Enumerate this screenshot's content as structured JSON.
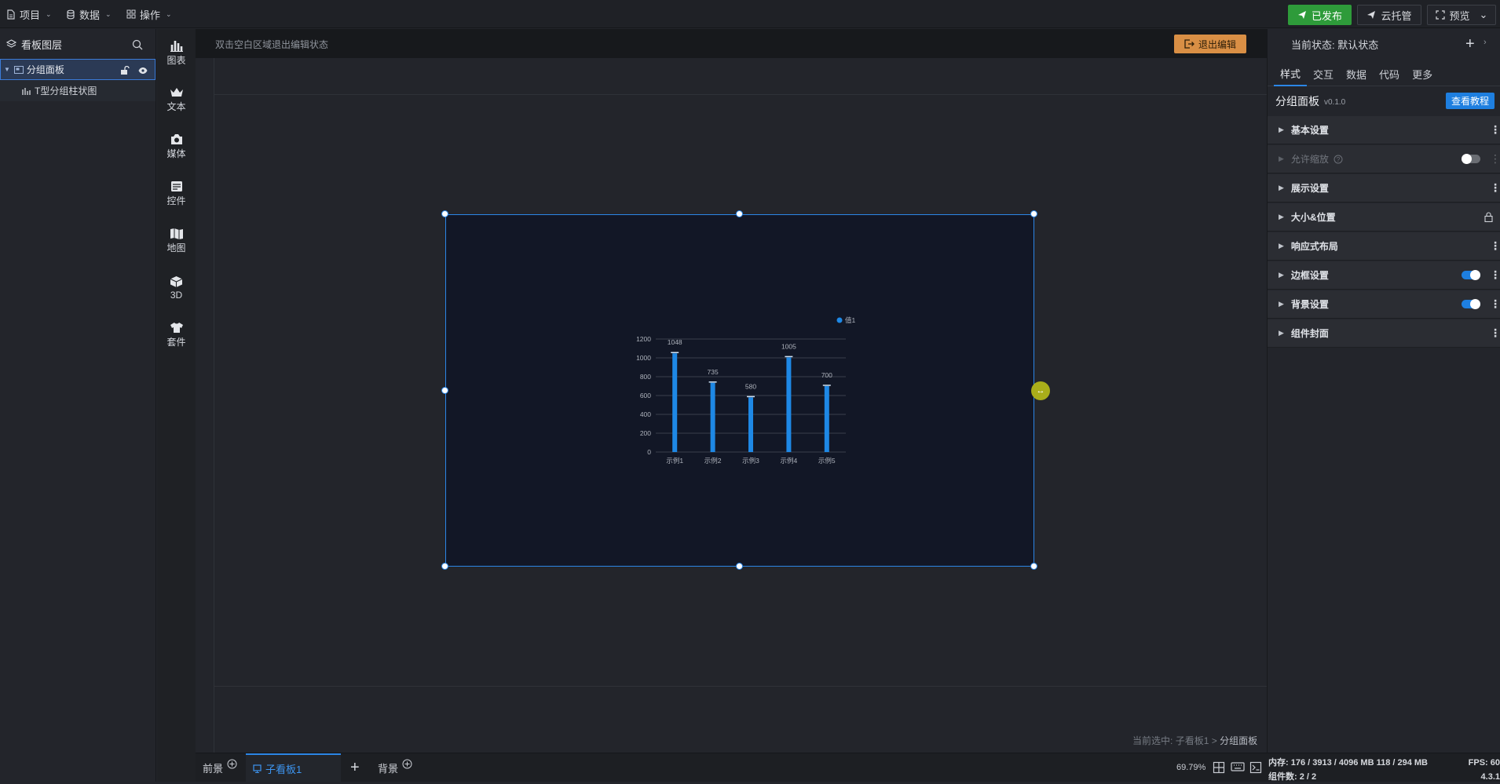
{
  "topbar": {
    "menus": [
      {
        "label": "项目",
        "icon": "file-icon"
      },
      {
        "label": "数据",
        "icon": "database-icon"
      },
      {
        "label": "操作",
        "icon": "grid-icon"
      }
    ],
    "published_label": "已发布",
    "cloud_label": "云托管",
    "preview_label": "预览"
  },
  "layers": {
    "title": "看板图层",
    "items": [
      {
        "label": "分组面板",
        "selected": true
      },
      {
        "label": "T型分组柱状图",
        "selected": false
      }
    ]
  },
  "component_tools": [
    {
      "label": "图表",
      "icon": "bar-chart-icon"
    },
    {
      "label": "文本",
      "icon": "crown-icon"
    },
    {
      "label": "媒体",
      "icon": "camera-icon"
    },
    {
      "label": "控件",
      "icon": "widget-icon"
    },
    {
      "label": "地图",
      "icon": "map-icon"
    },
    {
      "label": "3D",
      "icon": "cube-icon"
    },
    {
      "label": "套件",
      "icon": "shirt-icon"
    }
  ],
  "canvas": {
    "hint": "双击空白区域退出编辑状态",
    "exit_edit_label": "退出编辑",
    "breadcrumb_prefix": "当前选中:",
    "breadcrumb_path": "子看板1",
    "breadcrumb_sep": ">",
    "breadcrumb_current": "分组面板"
  },
  "chart_data": {
    "type": "bar",
    "categories": [
      "示例1",
      "示例2",
      "示例3",
      "示例4",
      "示例5"
    ],
    "series": [
      {
        "name": "值1",
        "values": [
          1048,
          735,
          580,
          1005,
          700
        ]
      }
    ],
    "y_ticks": [
      "0",
      "200",
      "400",
      "600",
      "800",
      "1000",
      "1200"
    ],
    "ylim": [
      0,
      1200
    ],
    "grid": true,
    "legend": "top-right",
    "bar_color": "#1e88e5"
  },
  "bottombar": {
    "tabs": [
      {
        "label": "前景"
      },
      {
        "label": "子看板1"
      },
      {
        "label": "背景"
      }
    ],
    "add_label": "+",
    "zoom": "69.79%",
    "memory": "内存: 176 / 3913 / 4096 MB  118 / 294 MB",
    "components": "组件数: 2 / 2",
    "fps": "FPS: 60",
    "version": "4.3.1"
  },
  "rpanel": {
    "state_label": "当前状态: 默认状态",
    "tabs": [
      "样式",
      "交互",
      "数据",
      "代码",
      "更多"
    ],
    "active_tab": "样式",
    "component_title": "分组面板",
    "component_version": "v0.1.0",
    "tutorial_label": "查看教程",
    "sections": [
      {
        "label": "基本设置",
        "control": "dots"
      },
      {
        "label": "允许缩放",
        "control": "toggle-off",
        "disabled": true
      },
      {
        "label": "展示设置",
        "control": "dots"
      },
      {
        "label": "大小&位置",
        "control": "lock"
      },
      {
        "label": "响应式布局",
        "control": "dots"
      },
      {
        "label": "边框设置",
        "control": "toggle-on"
      },
      {
        "label": "背景设置",
        "control": "toggle-on"
      },
      {
        "label": "组件封面",
        "control": "dots"
      }
    ]
  },
  "colors": {
    "accent": "#2b86e6",
    "published": "#2e9b3a",
    "exit_edit": "#d98f45",
    "panel_bg": "#121726"
  }
}
